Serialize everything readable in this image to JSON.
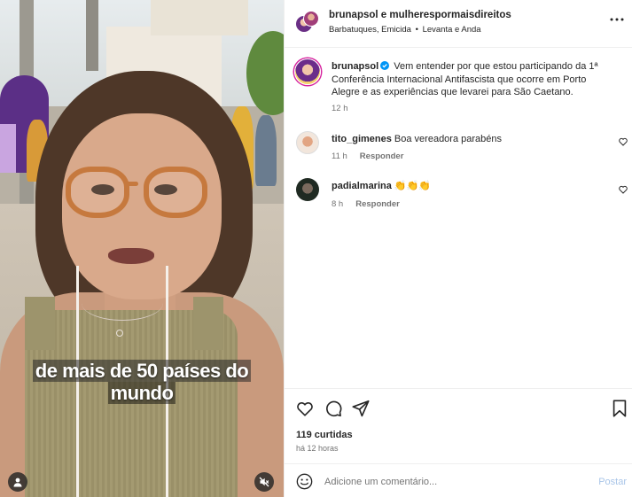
{
  "video": {
    "caption_line1": "de mais de 50 países do",
    "caption_line2": "mundo",
    "profile_icon": "person-icon",
    "mute_icon": "muted-speaker-icon"
  },
  "header": {
    "title": "brunapsol e mulherespormaisdireitos",
    "audio_artist": "Barbatuques, Emicida",
    "separator": "•",
    "audio_track": "Levanta e Anda",
    "more_icon": "more-options-icon"
  },
  "caption_post": {
    "username": "brunapsol",
    "text": "Vem entender por que estou participando da 1ª Conferência Internacional Antifascista que ocorre em Porto Alegre e as experiências que levarei para São Caetano.",
    "time": "12 h"
  },
  "comments": [
    {
      "username": "tito_gimenes",
      "text": "Boa vereadora parabéns",
      "time": "11 h",
      "reply_label": "Responder"
    },
    {
      "username": "padialmarina",
      "text": "👏👏👏",
      "time": "8 h",
      "reply_label": "Responder"
    }
  ],
  "actions": {
    "like_icon": "heart-icon",
    "comment_icon": "comment-icon",
    "share_icon": "share-icon",
    "save_icon": "bookmark-icon"
  },
  "stats": {
    "likes": "119 curtidas",
    "posted": "há 12 horas"
  },
  "add_comment": {
    "placeholder": "Adicione um comentário...",
    "post_label": "Postar",
    "emoji_icon": "emoji-icon"
  },
  "colors": {
    "text": "#262626",
    "secondary": "#737373",
    "post_disabled": "#a9c5e8",
    "verified": "#0095f6",
    "glasses": "#c6793e"
  }
}
